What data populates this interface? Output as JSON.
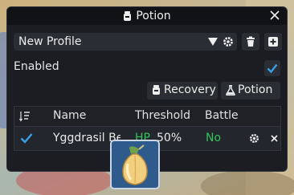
{
  "window": {
    "title": "Potion"
  },
  "profile": {
    "selected": "New Profile"
  },
  "settings": {
    "enabled_label": "Enabled",
    "enabled": true
  },
  "buttons": {
    "recovery": "Recovery",
    "potion": "Potion"
  },
  "table": {
    "headers": {
      "name": "Name",
      "threshold": "Threshold",
      "battle": "Battle"
    },
    "rows": [
      {
        "checked": true,
        "name": "Yggdrasil Berry",
        "threshold_stat": "HP",
        "threshold_value": "50%",
        "battle": "No"
      }
    ]
  },
  "colors": {
    "accent_check": "#3aa0e6",
    "green": "#33c45a",
    "window_bg": "#1b1d22"
  },
  "icons": [
    "potion-icon",
    "close-icon",
    "dropdown-arrow-icon",
    "gear-icon",
    "trash-icon",
    "plus-icon",
    "check-icon",
    "flask-icon",
    "sort-icon",
    "remove-icon",
    "yggdrasil-berry-item-icon"
  ]
}
